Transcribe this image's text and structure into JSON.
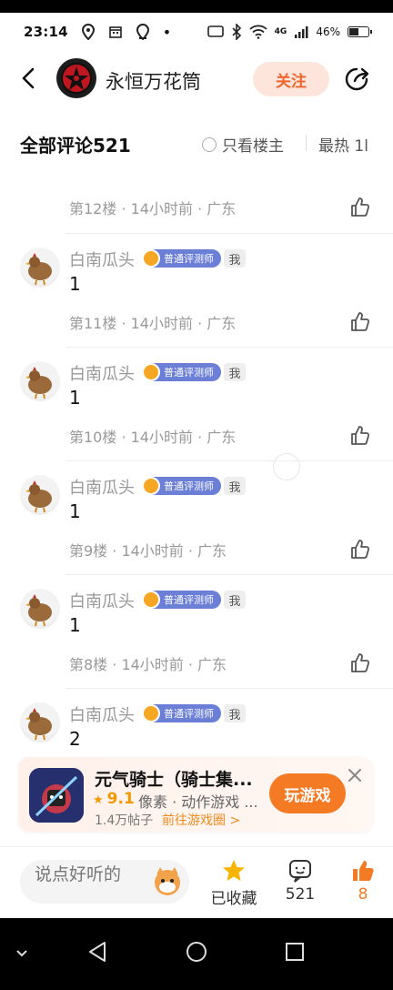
{
  "status_bar": {
    "time": "23:14",
    "network": "4G",
    "battery": "46%"
  },
  "header": {
    "title": "永恒万花筒",
    "follow_label": "关注"
  },
  "comments_header": {
    "title": "全部评论521",
    "only_owner_label": "只看楼主",
    "sort_label": "最热 1l"
  },
  "comments": [
    {
      "floor_meta": "第12楼 · 14小时前 · 广东"
    },
    {
      "username": "白南瓜头",
      "badge": "普通评测师",
      "me_tag": "我",
      "body": "1",
      "floor_meta": "第11楼 · 14小时前 · 广东"
    },
    {
      "username": "白南瓜头",
      "badge": "普通评测师",
      "me_tag": "我",
      "body": "1",
      "floor_meta": "第10楼 · 14小时前 · 广东"
    },
    {
      "username": "白南瓜头",
      "badge": "普通评测师",
      "me_tag": "我",
      "body": "1",
      "floor_meta": "第9楼 · 14小时前 · 广东"
    },
    {
      "username": "白南瓜头",
      "badge": "普通评测师",
      "me_tag": "我",
      "body": "1",
      "floor_meta": "第8楼 · 14小时前 · 广东"
    },
    {
      "username": "白南瓜头",
      "badge": "普通评测师",
      "me_tag": "我",
      "body": "2"
    }
  ],
  "game_card": {
    "name": "元气骑士（骑士集...",
    "rating": "9.1",
    "genre": "像素 · 动作游戏 ...",
    "posts": "1.4万帖子",
    "goto_circle": "前往游戏圈 >",
    "play_label": "玩游戏"
  },
  "bottom_bar": {
    "reply_placeholder": "说点好听的",
    "collected_label": "已收藏",
    "comment_count": "521",
    "like_count": "8"
  },
  "colors": {
    "accent": "#f47a24",
    "follow_bg": "#fde5dc",
    "badge": "#6c7fd6",
    "meta": "#999999"
  }
}
